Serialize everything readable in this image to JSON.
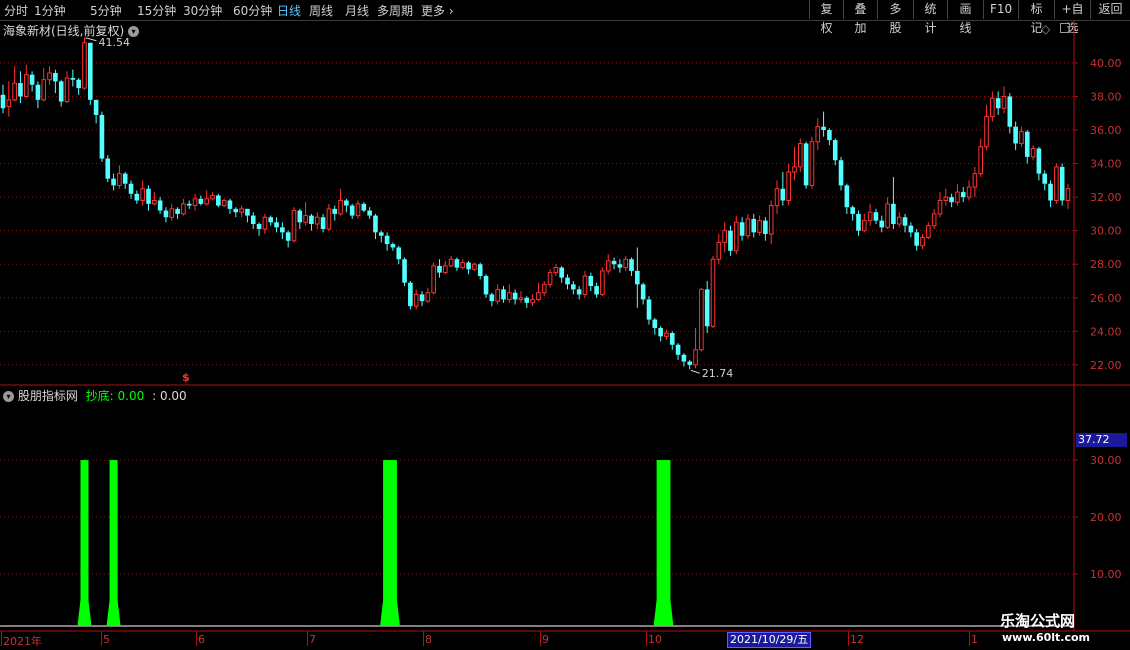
{
  "toolbar": {
    "periods": [
      "分时",
      "1分钟",
      "5分钟",
      "15分钟",
      "30分钟",
      "60分钟",
      "日线",
      "周线",
      "月线",
      "多周期",
      "更多"
    ],
    "active_period": "日线",
    "buttons": [
      "复权",
      "叠加",
      "多股",
      "统计",
      "画线",
      "F10",
      "标记",
      "+自选",
      "返回"
    ]
  },
  "stock": {
    "title": "海象新材(日线,前复权)"
  },
  "main_axis": {
    "labels": [
      "40.00",
      "38.00",
      "36.00",
      "34.00",
      "32.00",
      "30.00",
      "28.00",
      "26.00",
      "24.00",
      "22.00"
    ]
  },
  "annotations": {
    "high": "41.54",
    "low": "21.74",
    "marker": "$"
  },
  "indicator": {
    "name": "股朋指标网",
    "line_label": "抄底:",
    "line_value": "0.00",
    "extra": ": 0.00"
  },
  "indicator_axis": {
    "labels": [
      "30.00",
      "20.00",
      "10.00"
    ],
    "current": "37.72"
  },
  "x_axis": {
    "labels": [
      "2021年",
      "5",
      "6",
      "7",
      "8",
      "9",
      "10",
      "12",
      "1"
    ],
    "cursor_date": "2021/10/29/五"
  },
  "watermark": {
    "title": "乐淘公式网",
    "url": "www.60lt.com"
  },
  "colors": {
    "up": "#ff3232",
    "down": "#54ffff",
    "signal": "#00ff00",
    "axis": "#b01010"
  },
  "chart_data": {
    "type": "candlestick",
    "ylim": [
      20.8,
      42.5
    ],
    "bars": [
      [
        38.1,
        37.3,
        37.0,
        38.7
      ],
      [
        37.4,
        37.8,
        36.8,
        38.9
      ],
      [
        37.8,
        38.8,
        37.7,
        39.8
      ],
      [
        38.8,
        38.0,
        37.6,
        39.5
      ],
      [
        38.0,
        39.3,
        37.9,
        39.9
      ],
      [
        39.3,
        38.7,
        38.3,
        39.5
      ],
      [
        38.7,
        37.8,
        37.3,
        38.9
      ],
      [
        37.8,
        39.0,
        37.7,
        39.7
      ],
      [
        39.0,
        39.4,
        38.7,
        39.8
      ],
      [
        39.4,
        38.9,
        38.2,
        39.6
      ],
      [
        38.9,
        37.7,
        37.4,
        39.0
      ],
      [
        37.7,
        39.1,
        37.6,
        39.5
      ],
      [
        39.1,
        39.0,
        38.6,
        39.6
      ],
      [
        39.0,
        38.5,
        38.1,
        39.1
      ],
      [
        38.5,
        41.2,
        38.4,
        41.5
      ],
      [
        41.2,
        37.8,
        37.5,
        41.2
      ],
      [
        37.8,
        36.9,
        36.4,
        37.8
      ],
      [
        36.9,
        34.3,
        34.1,
        37.1
      ],
      [
        34.3,
        33.1,
        32.9,
        34.5
      ],
      [
        33.1,
        32.7,
        32.4,
        33.4
      ],
      [
        32.7,
        33.4,
        32.5,
        33.9
      ],
      [
        33.4,
        32.8,
        32.5,
        33.5
      ],
      [
        32.8,
        32.2,
        31.9,
        33.0
      ],
      [
        32.2,
        31.8,
        31.6,
        32.4
      ],
      [
        31.8,
        32.5,
        31.5,
        33.0
      ],
      [
        32.5,
        31.6,
        31.2,
        32.7
      ],
      [
        31.6,
        31.8,
        31.5,
        32.3
      ],
      [
        31.8,
        31.2,
        31.0,
        32.0
      ],
      [
        31.2,
        30.8,
        30.5,
        31.4
      ],
      [
        30.8,
        31.3,
        30.6,
        31.6
      ],
      [
        31.3,
        31.0,
        30.7,
        31.4
      ],
      [
        31.0,
        31.6,
        30.9,
        31.9
      ],
      [
        31.6,
        31.5,
        31.3,
        31.8
      ],
      [
        31.5,
        31.9,
        31.2,
        32.2
      ],
      [
        31.9,
        31.6,
        31.5,
        32.1
      ],
      [
        31.6,
        31.9,
        31.5,
        32.4
      ],
      [
        31.9,
        32.1,
        31.8,
        32.3
      ],
      [
        32.1,
        31.5,
        31.4,
        32.2
      ],
      [
        31.5,
        31.8,
        31.4,
        31.9
      ],
      [
        31.8,
        31.3,
        31.0,
        31.9
      ],
      [
        31.3,
        31.1,
        30.8,
        31.4
      ],
      [
        31.1,
        31.3,
        30.8,
        31.5
      ],
      [
        31.3,
        30.9,
        30.5,
        31.3
      ],
      [
        30.9,
        30.4,
        30.1,
        31.1
      ],
      [
        30.4,
        30.1,
        29.7,
        30.5
      ],
      [
        30.1,
        30.8,
        29.8,
        31.0
      ],
      [
        30.8,
        30.5,
        30.3,
        30.9
      ],
      [
        30.5,
        30.2,
        29.9,
        30.8
      ],
      [
        30.2,
        29.9,
        29.5,
        30.5
      ],
      [
        29.9,
        29.4,
        29.0,
        30.0
      ],
      [
        29.4,
        31.2,
        29.3,
        31.4
      ],
      [
        31.2,
        30.5,
        30.1,
        31.3
      ],
      [
        30.5,
        30.9,
        30.3,
        31.7
      ],
      [
        30.9,
        30.4,
        30.0,
        31.0
      ],
      [
        30.4,
        30.8,
        30.1,
        31.1
      ],
      [
        30.8,
        30.1,
        29.9,
        31.0
      ],
      [
        30.1,
        31.3,
        30.0,
        31.6
      ],
      [
        31.3,
        31.0,
        30.6,
        31.5
      ],
      [
        31.0,
        31.8,
        30.9,
        32.5
      ],
      [
        31.8,
        31.5,
        31.1,
        31.9
      ],
      [
        31.5,
        30.9,
        30.7,
        31.6
      ],
      [
        30.9,
        31.6,
        30.7,
        31.8
      ],
      [
        31.6,
        31.2,
        31.1,
        31.7
      ],
      [
        31.2,
        30.9,
        30.7,
        31.4
      ],
      [
        30.9,
        29.9,
        29.5,
        31.0
      ],
      [
        29.9,
        29.7,
        29.3,
        30.0
      ],
      [
        29.7,
        29.2,
        28.8,
        29.9
      ],
      [
        29.2,
        29.0,
        28.8,
        29.3
      ],
      [
        29.0,
        28.3,
        28.0,
        29.1
      ],
      [
        28.3,
        26.9,
        26.7,
        28.4
      ],
      [
        26.9,
        25.5,
        25.3,
        27.0
      ],
      [
        25.5,
        26.2,
        25.3,
        26.5
      ],
      [
        26.2,
        25.8,
        25.5,
        26.4
      ],
      [
        25.8,
        26.3,
        25.7,
        26.6
      ],
      [
        26.3,
        27.9,
        26.2,
        28.1
      ],
      [
        27.9,
        27.5,
        27.2,
        28.3
      ],
      [
        27.5,
        27.9,
        27.4,
        28.2
      ],
      [
        27.9,
        28.3,
        27.8,
        28.5
      ],
      [
        28.3,
        27.8,
        27.6,
        28.4
      ],
      [
        27.8,
        28.1,
        27.7,
        28.3
      ],
      [
        28.1,
        27.7,
        27.4,
        28.2
      ],
      [
        27.7,
        28.0,
        27.6,
        28.1
      ],
      [
        28.0,
        27.3,
        27.1,
        28.1
      ],
      [
        27.3,
        26.2,
        26.0,
        27.4
      ],
      [
        26.2,
        25.8,
        25.5,
        26.3
      ],
      [
        25.8,
        26.5,
        25.6,
        26.8
      ],
      [
        26.5,
        25.9,
        25.7,
        26.7
      ],
      [
        25.9,
        26.3,
        25.7,
        26.8
      ],
      [
        26.3,
        25.9,
        25.6,
        26.5
      ],
      [
        25.9,
        26.0,
        25.7,
        26.4
      ],
      [
        26.0,
        25.7,
        25.4,
        26.1
      ],
      [
        25.7,
        25.9,
        25.5,
        26.2
      ],
      [
        25.9,
        26.3,
        25.8,
        26.9
      ],
      [
        26.3,
        26.8,
        26.1,
        27.0
      ],
      [
        26.8,
        27.5,
        26.6,
        27.7
      ],
      [
        27.5,
        27.8,
        27.3,
        28.0
      ],
      [
        27.8,
        27.2,
        26.9,
        27.9
      ],
      [
        27.2,
        26.8,
        26.5,
        27.4
      ],
      [
        26.8,
        26.5,
        26.2,
        27.0
      ],
      [
        26.5,
        26.2,
        25.9,
        26.7
      ],
      [
        26.2,
        27.3,
        26.0,
        27.6
      ],
      [
        27.3,
        26.7,
        26.4,
        27.5
      ],
      [
        26.7,
        26.2,
        26.0,
        26.9
      ],
      [
        26.2,
        27.6,
        26.1,
        27.8
      ],
      [
        27.6,
        28.2,
        27.4,
        28.6
      ],
      [
        28.2,
        28.0,
        27.7,
        28.4
      ],
      [
        28.0,
        27.8,
        27.5,
        28.3
      ],
      [
        27.8,
        28.3,
        27.6,
        28.5
      ],
      [
        28.3,
        27.6,
        27.3,
        28.4
      ],
      [
        27.6,
        26.8,
        25.4,
        29.0
      ],
      [
        26.8,
        25.9,
        25.6,
        26.9
      ],
      [
        25.9,
        24.7,
        24.4,
        26.1
      ],
      [
        24.7,
        24.2,
        23.8,
        24.8
      ],
      [
        24.2,
        23.7,
        23.4,
        24.3
      ],
      [
        23.7,
        23.9,
        23.5,
        24.1
      ],
      [
        23.9,
        23.2,
        22.9,
        24.0
      ],
      [
        23.2,
        22.6,
        22.3,
        23.3
      ],
      [
        22.6,
        22.2,
        21.9,
        22.7
      ],
      [
        22.2,
        22.0,
        21.74,
        22.3
      ],
      [
        22.0,
        22.9,
        21.8,
        24.2
      ],
      [
        22.9,
        26.5,
        22.8,
        26.6
      ],
      [
        26.5,
        24.3,
        23.9,
        27.0
      ],
      [
        24.3,
        28.3,
        24.2,
        28.5
      ],
      [
        28.3,
        29.3,
        28.0,
        29.8
      ],
      [
        29.3,
        30.0,
        28.7,
        30.5
      ],
      [
        30.0,
        28.8,
        28.5,
        30.3
      ],
      [
        28.8,
        30.5,
        28.6,
        30.9
      ],
      [
        30.5,
        29.7,
        29.4,
        30.8
      ],
      [
        29.7,
        30.7,
        29.5,
        31.0
      ],
      [
        30.7,
        29.9,
        29.6,
        31.0
      ],
      [
        29.9,
        30.6,
        29.7,
        30.9
      ],
      [
        30.6,
        29.8,
        29.4,
        30.8
      ],
      [
        29.8,
        31.5,
        29.2,
        31.8
      ],
      [
        31.5,
        32.5,
        31.0,
        33.0
      ],
      [
        32.5,
        31.8,
        31.5,
        33.5
      ],
      [
        31.8,
        33.5,
        31.5,
        34.0
      ],
      [
        33.5,
        33.8,
        33.0,
        35.0
      ],
      [
        33.8,
        35.2,
        33.5,
        35.5
      ],
      [
        35.2,
        32.7,
        32.5,
        35.3
      ],
      [
        32.7,
        35.3,
        32.5,
        35.6
      ],
      [
        35.3,
        36.2,
        34.8,
        36.7
      ],
      [
        36.2,
        36.0,
        35.6,
        37.1
      ],
      [
        36.0,
        35.4,
        35.1,
        36.1
      ],
      [
        35.4,
        34.2,
        33.9,
        35.5
      ],
      [
        34.2,
        32.7,
        32.4,
        34.4
      ],
      [
        32.7,
        31.4,
        31.0,
        32.8
      ],
      [
        31.4,
        31.0,
        30.6,
        31.5
      ],
      [
        31.0,
        30.0,
        29.7,
        31.2
      ],
      [
        30.0,
        30.6,
        29.9,
        31.0
      ],
      [
        30.6,
        31.1,
        30.3,
        31.6
      ],
      [
        31.1,
        30.6,
        30.4,
        31.3
      ],
      [
        30.6,
        30.2,
        29.9,
        30.9
      ],
      [
        30.2,
        31.6,
        30.1,
        32.0
      ],
      [
        31.6,
        30.4,
        30.1,
        33.2
      ],
      [
        30.4,
        30.8,
        30.2,
        31.1
      ],
      [
        30.8,
        30.3,
        29.9,
        31.0
      ],
      [
        30.3,
        29.9,
        29.6,
        30.5
      ],
      [
        29.9,
        29.1,
        28.8,
        30.1
      ],
      [
        29.1,
        29.6,
        28.9,
        29.8
      ],
      [
        29.6,
        30.3,
        29.5,
        30.5
      ],
      [
        30.3,
        31.0,
        30.1,
        31.3
      ],
      [
        31.0,
        31.8,
        30.8,
        32.3
      ],
      [
        31.8,
        32.0,
        31.5,
        32.5
      ],
      [
        32.0,
        31.7,
        31.4,
        32.2
      ],
      [
        31.7,
        32.3,
        31.5,
        32.8
      ],
      [
        32.3,
        32.0,
        31.7,
        32.6
      ],
      [
        32.0,
        32.6,
        31.8,
        33.0
      ],
      [
        32.6,
        33.4,
        32.0,
        33.8
      ],
      [
        33.4,
        35.0,
        33.2,
        35.5
      ],
      [
        35.0,
        36.8,
        34.8,
        37.5
      ],
      [
        36.8,
        37.9,
        36.5,
        38.3
      ],
      [
        37.9,
        37.3,
        36.9,
        38.3
      ],
      [
        37.3,
        38.0,
        37.0,
        38.6
      ],
      [
        38.0,
        36.2,
        35.8,
        38.2
      ],
      [
        36.2,
        35.2,
        34.8,
        36.5
      ],
      [
        35.2,
        35.9,
        35.0,
        36.2
      ],
      [
        35.9,
        34.4,
        34.0,
        36.0
      ],
      [
        34.4,
        34.9,
        34.2,
        35.1
      ],
      [
        34.9,
        33.4,
        33.0,
        35.0
      ],
      [
        33.4,
        32.8,
        32.4,
        33.6
      ],
      [
        32.8,
        31.8,
        31.4,
        33.0
      ],
      [
        31.8,
        33.8,
        31.6,
        34.0
      ],
      [
        33.8,
        31.8,
        31.5,
        34.0
      ],
      [
        31.8,
        32.5,
        31.3,
        32.8
      ]
    ],
    "signals": [
      {
        "x": 14,
        "value": 30
      },
      {
        "x": 19,
        "value": 30
      },
      {
        "x": 66,
        "value": 30
      },
      {
        "x": 67,
        "value": 30
      },
      {
        "x": 113,
        "value": 30
      },
      {
        "x": 114,
        "value": 30
      }
    ],
    "indicator_ylim": [
      0,
      43
    ]
  }
}
